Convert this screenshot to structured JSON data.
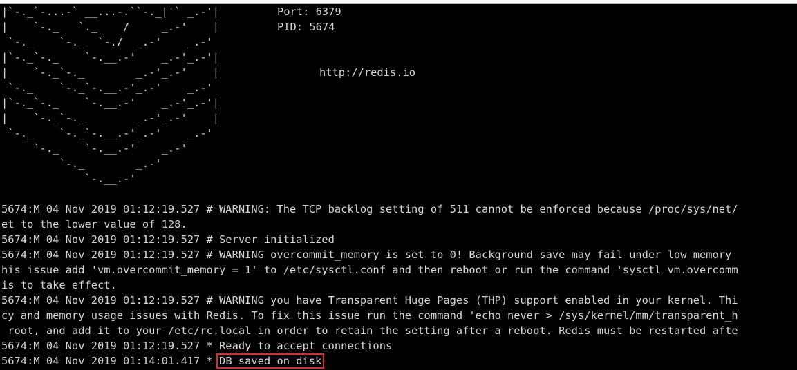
{
  "terminal": {
    "logo": [
      "|`-._`-...-` __...-.``-._|'` _.-'|",
      "|    `-._   `._    /     _.-'    |",
      " `-._    `-._  `-./  _.-'    _.-'",
      "|`-._`-._    `-.__.-'    _.-'_.-'|",
      "|    `-._`-._        _.-'_.-'    |",
      " `-._    `-._`-.__.-'_.-'    _.-'",
      "|`-._`-._    `-.__.-'    _.-'_.-'|",
      "|    `-._`-._        _.-'_.-'    |",
      " `-._    `-._`-.__.-'_.-'    _.-'",
      "     `-._    `-.__.-'    _.-'",
      "         `-._        _.-'",
      "             `-.__.-'"
    ],
    "info": {
      "port": "Port: 6379",
      "pid": "PID: 5674",
      "url": "http://redis.io"
    },
    "log": [
      "5674:M 04 Nov 2019 01:12:19.527 # WARNING: The TCP backlog setting of 511 cannot be enforced because /proc/sys/net/",
      "et to the lower value of 128.",
      "5674:M 04 Nov 2019 01:12:19.527 # Server initialized",
      "5674:M 04 Nov 2019 01:12:19.527 # WARNING overcommit_memory is set to 0! Background save may fail under low memory",
      "his issue add 'vm.overcommit_memory = 1' to /etc/sysctl.conf and then reboot or run the command 'sysctl vm.overcomm",
      "is to take effect.",
      "5674:M 04 Nov 2019 01:12:19.527 # WARNING you have Transparent Huge Pages (THP) support enabled in your kernel. Thi",
      "cy and memory usage issues with Redis. To fix this issue run the command 'echo never > /sys/kernel/mm/transparent_h",
      " root, and add it to your /etc/rc.local in order to retain the setting after a reboot. Redis must be restarted afte",
      "5674:M 04 Nov 2019 01:12:19.527 * Ready to accept connections"
    ],
    "last_line_prefix": "5674:M 04 Nov 2019 01:14:01.417 * ",
    "last_line_highlight": "DB saved on disk"
  }
}
